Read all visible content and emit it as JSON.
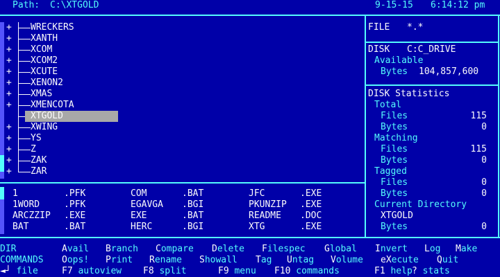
{
  "header": {
    "path_label": "Path:",
    "path_value": "C:\\XTGOLD",
    "date": "9-15-15",
    "time": "6:14:12 pm"
  },
  "tree": {
    "items": [
      {
        "mark": "+",
        "label": "WRECKERS"
      },
      {
        "mark": "+",
        "label": "XANTH"
      },
      {
        "mark": "+",
        "label": "XCOM"
      },
      {
        "mark": "+",
        "label": "XCOM2"
      },
      {
        "mark": "+",
        "label": "XCUTE"
      },
      {
        "mark": "+",
        "label": "XENON2"
      },
      {
        "mark": "+",
        "label": "XMAS"
      },
      {
        "mark": "+",
        "label": "XMENCOTA"
      },
      {
        "mark": "",
        "label": "XTGOLD"
      },
      {
        "mark": "+",
        "label": "XWING"
      },
      {
        "mark": "+",
        "label": "YS"
      },
      {
        "mark": "+",
        "label": "Z"
      },
      {
        "mark": "+",
        "label": "ZAK"
      },
      {
        "mark": "+",
        "label": "ZAR"
      }
    ],
    "selected": "XTGOLD"
  },
  "files": {
    "columns": [
      [
        {
          "name": "1",
          "ext": ".PFK"
        },
        {
          "name": "1WORD",
          "ext": ".PFK"
        },
        {
          "name": "ARCZZIP",
          "ext": ".EXE"
        },
        {
          "name": "BAT",
          "ext": ".BAT"
        }
      ],
      [
        {
          "name": "COM",
          "ext": ".BAT"
        },
        {
          "name": "EGAVGA",
          "ext": ".BGI"
        },
        {
          "name": "EXE",
          "ext": ".BAT"
        },
        {
          "name": "HERC",
          "ext": ".BGI"
        }
      ],
      [
        {
          "name": "JFC",
          "ext": ".EXE"
        },
        {
          "name": "PKUNZIP",
          "ext": ".EXE"
        },
        {
          "name": "README",
          "ext": ".DOC"
        },
        {
          "name": "XTG",
          "ext": ".EXE"
        }
      ]
    ]
  },
  "info": {
    "file_label": "FILE",
    "file_spec": "*.*",
    "disk_label": "DISK",
    "disk_name": "C:C_DRIVE",
    "available_label": "Available",
    "bytes_label": "Bytes",
    "available_bytes": "104,857,600",
    "stats_title": "DISK Statistics",
    "total_label": "Total",
    "files_label": "Files",
    "total_files": "115",
    "total_bytes": "0",
    "matching_label": "Matching",
    "matching_files": "115",
    "matching_bytes": "0",
    "tagged_label": "Tagged",
    "tagged_files": "0",
    "tagged_bytes": "0",
    "current_dir_label": "Current Directory",
    "current_dir": "XTGOLD",
    "current_bytes": "0"
  },
  "menu": {
    "row1_label": "DIR",
    "row1": [
      {
        "key": "A",
        "rest": "vail"
      },
      {
        "key": "B",
        "rest": "ranch"
      },
      {
        "key": "C",
        "rest": "ompare"
      },
      {
        "key": "D",
        "rest": "elete"
      },
      {
        "key": "F",
        "rest": "ilespec"
      },
      {
        "key": "G",
        "rest": "lobal"
      },
      {
        "key": "I",
        "rest": "nvert"
      },
      {
        "key": "L",
        "rest": "og"
      },
      {
        "key": "M",
        "rest": "ake"
      }
    ],
    "row2_label": "COMMANDS",
    "row2": [
      {
        "key": "O",
        "rest": "ops!"
      },
      {
        "key": "P",
        "rest": "rint"
      },
      {
        "key": "R",
        "rest": "ename"
      },
      {
        "key": "S",
        "rest": "howall"
      },
      {
        "key": "T",
        "rest": "ag"
      },
      {
        "key": "U",
        "rest": "ntag"
      },
      {
        "key": "V",
        "rest": "olume"
      },
      {
        "key": "eX",
        "rest": "ecute"
      },
      {
        "key": "Q",
        "rest": "uit"
      }
    ],
    "row3": [
      {
        "key": "◄┘",
        "rest": " file"
      },
      {
        "key": "F7",
        "rest": " autoview"
      },
      {
        "key": "F8",
        "rest": " split"
      },
      {
        "key": "F9",
        "rest": " menu"
      },
      {
        "key": "F10",
        "rest": " commands"
      },
      {
        "key": "F1",
        "rest": " help"
      },
      {
        "key": "?",
        "rest": " stats"
      }
    ]
  }
}
